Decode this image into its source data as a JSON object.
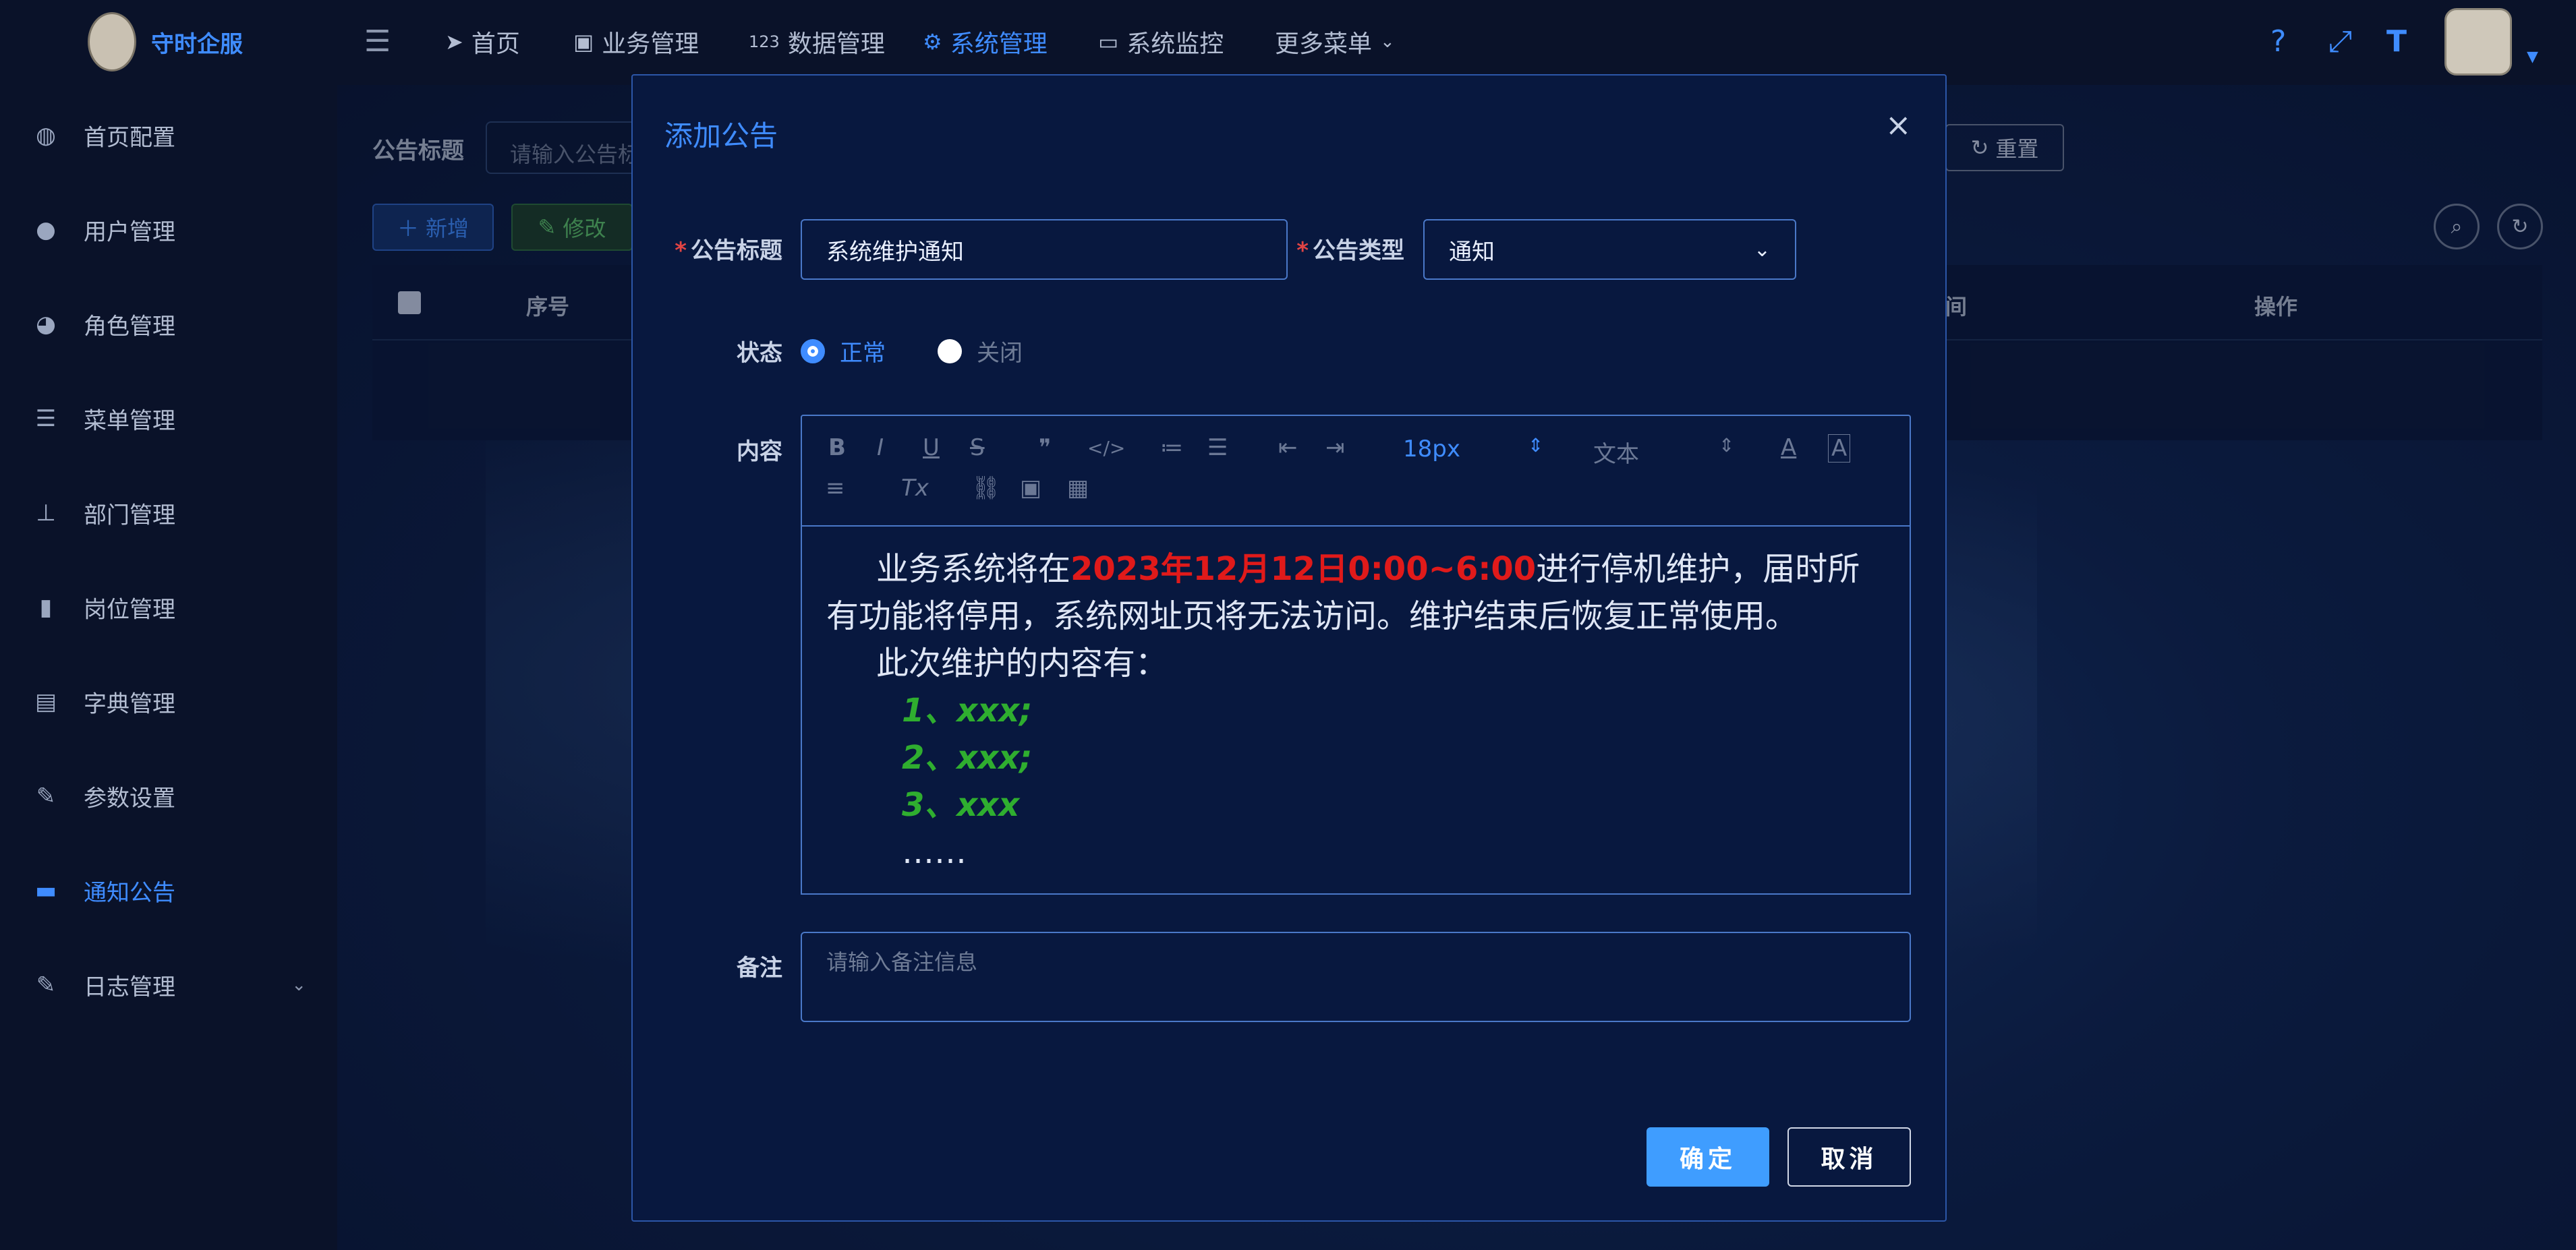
{
  "app": {
    "title": "守时企服"
  },
  "sidebar": {
    "items": [
      {
        "label": "首页配置",
        "icon": "dashboard-icon"
      },
      {
        "label": "用户管理",
        "icon": "user-icon"
      },
      {
        "label": "角色管理",
        "icon": "users-icon"
      },
      {
        "label": "菜单管理",
        "icon": "menu-list-icon"
      },
      {
        "label": "部门管理",
        "icon": "org-tree-icon"
      },
      {
        "label": "岗位管理",
        "icon": "post-icon"
      },
      {
        "label": "字典管理",
        "icon": "dictionary-icon"
      },
      {
        "label": "参数设置",
        "icon": "edit-icon"
      },
      {
        "label": "通知公告",
        "icon": "message-icon",
        "active": true
      },
      {
        "label": "日志管理",
        "icon": "log-icon"
      }
    ]
  },
  "topnav": {
    "items": [
      {
        "label": "首页",
        "icon": "send-icon"
      },
      {
        "label": "业务管理",
        "icon": "doc-edit-icon"
      },
      {
        "label": "数据管理",
        "icon": "number-icon"
      },
      {
        "label": "系统管理",
        "icon": "gear-icon",
        "active": true
      },
      {
        "label": "系统监控",
        "icon": "monitor-icon"
      },
      {
        "label": "更多菜单",
        "icon": "chevron-down-icon"
      }
    ]
  },
  "background": {
    "search_label": "公告标题",
    "search_placeholder": "请输入公告标",
    "reset_label": "重置",
    "add_label": "新增",
    "edit_label": "修改",
    "col_index": "序号",
    "col_time": "间",
    "col_actions": "操作"
  },
  "dialog": {
    "title": "添加公告",
    "fields": {
      "title_label": "公告标题",
      "title_value": "系统维护通知",
      "type_label": "公告类型",
      "type_value": "通知",
      "status_label": "状态",
      "status_options": [
        "正常",
        "关闭"
      ],
      "status_selected": "正常",
      "content_label": "内容",
      "remark_label": "备注",
      "remark_placeholder": "请输入备注信息"
    },
    "editor": {
      "font_size": "18px",
      "format": "文本",
      "para1_prefix": "业务系统将在",
      "para1_date": "2023年12月12日0:00~6:00",
      "para1_suffix": "进行停机维护，届时所有功能将停用，系统网址页将无法访问。维护结束后恢复正常使用。",
      "para2": "此次维护的内容有：",
      "list": [
        "1、xxx;",
        "2、xxx;",
        "3、xxx"
      ],
      "ellipsis": "……"
    },
    "buttons": {
      "ok": "确定",
      "cancel": "取消"
    }
  },
  "colors": {
    "accent": "#3f8cff",
    "date_red": "#e01a1a",
    "list_green": "#2fae2f"
  }
}
